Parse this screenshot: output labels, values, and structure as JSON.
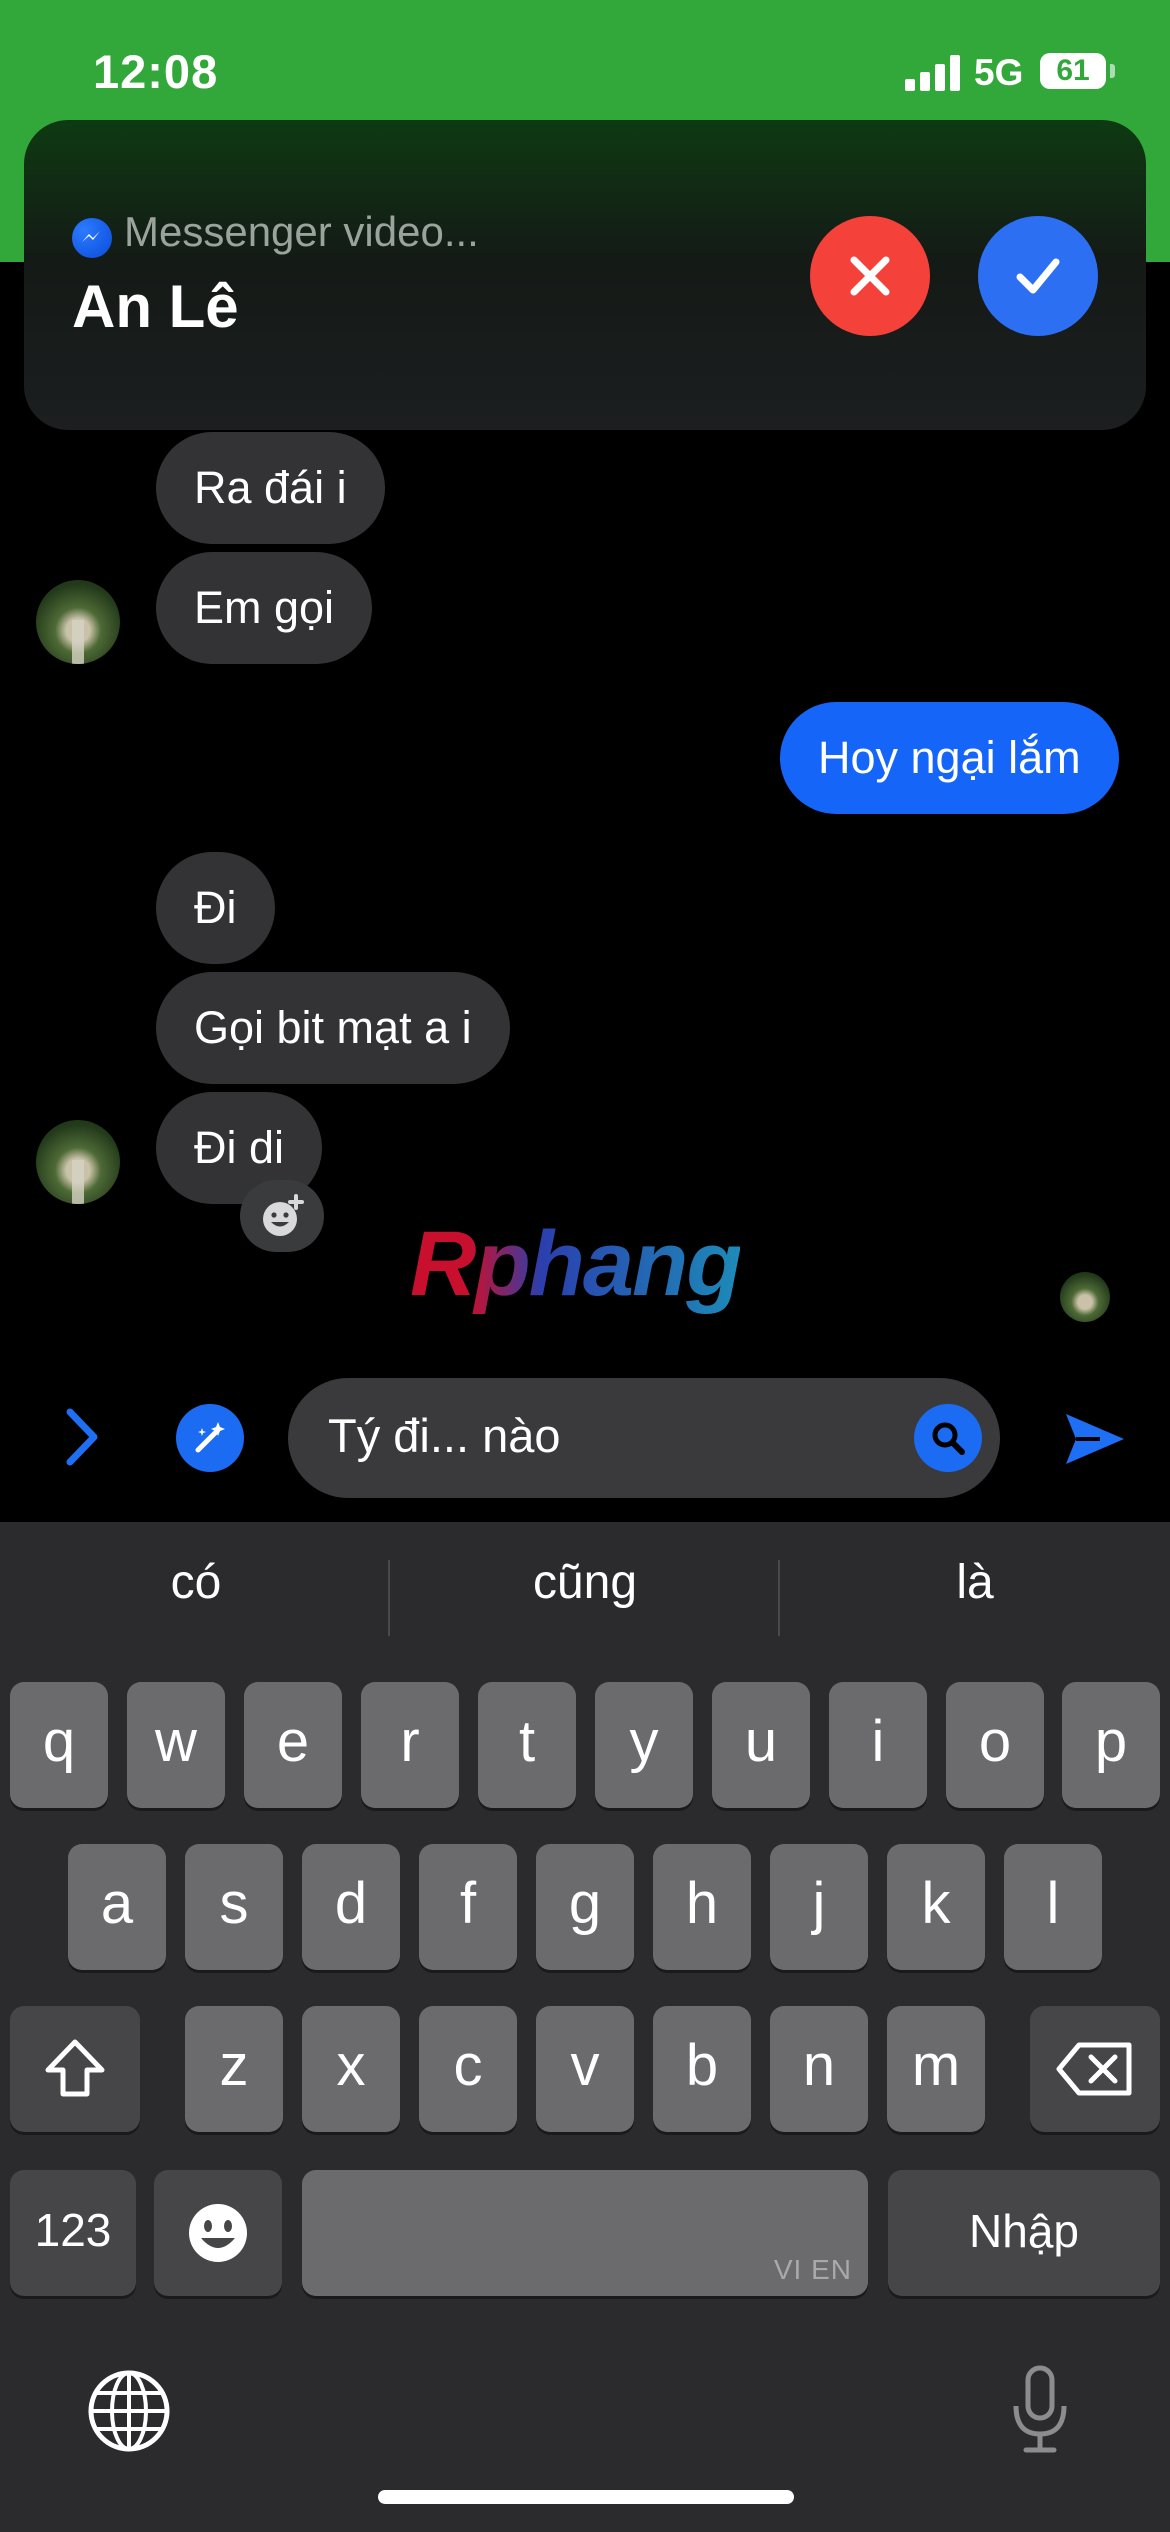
{
  "status_bar": {
    "time": "12:08",
    "network": "5G",
    "battery": "61"
  },
  "call_banner": {
    "app_subtitle": "Messenger video...",
    "caller_name": "An Lê"
  },
  "messages": [
    {
      "text": "Ra đái i",
      "sender": "contact"
    },
    {
      "text": "Em gọi",
      "sender": "contact"
    },
    {
      "text": "Hoy ngại lắm",
      "sender": "me"
    },
    {
      "text": "Đi",
      "sender": "contact"
    },
    {
      "text": "Gọi bit mạt a i",
      "sender": "contact"
    },
    {
      "text": "Đi di",
      "sender": "contact"
    }
  ],
  "watermark": "Rphang",
  "composer": {
    "text": "Tý đi... nào"
  },
  "keyboard": {
    "suggestions": [
      "có",
      "cũng",
      "là"
    ],
    "row1": [
      "q",
      "w",
      "e",
      "r",
      "t",
      "y",
      "u",
      "i",
      "o",
      "p"
    ],
    "row2": [
      "a",
      "s",
      "d",
      "f",
      "g",
      "h",
      "j",
      "k",
      "l"
    ],
    "row3": [
      "z",
      "x",
      "c",
      "v",
      "b",
      "n",
      "m"
    ],
    "numbers_key": "123",
    "enter_key": "Nhập",
    "space_language": "VI EN"
  },
  "colors": {
    "status_green": "#33a83a",
    "accent_blue": "#1565f8",
    "decline_red": "#f4413a"
  }
}
